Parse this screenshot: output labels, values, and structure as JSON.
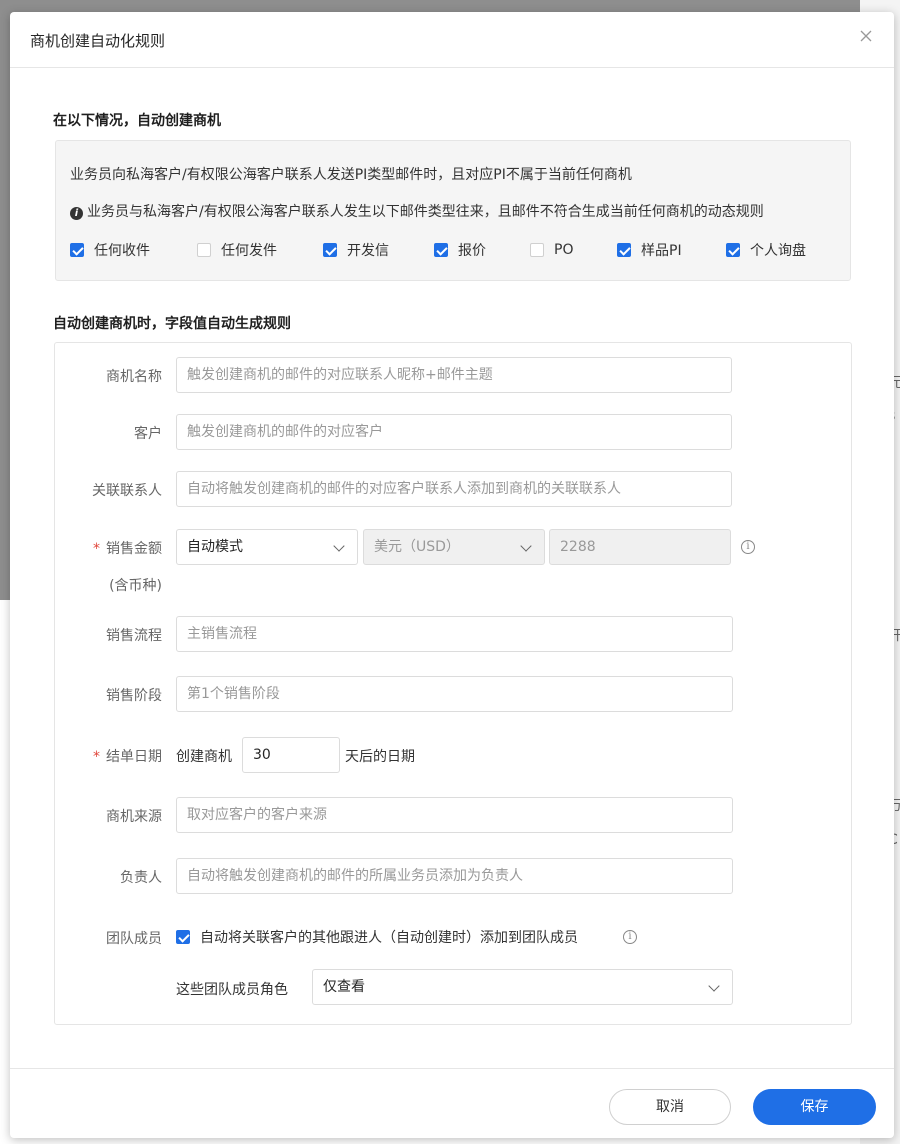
{
  "background": {
    "marks": [
      "I",
      "I",
      "元",
      "s",
      "开",
      "万",
      "C"
    ]
  },
  "dialog": {
    "title": "商机创建自动化规则"
  },
  "trigger_section": {
    "title": "在以下情况，自动创建商机",
    "line1": "业务员向私海客户/有权限公海客户联系人发送PI类型邮件时，且对应PI不属于当前任何商机",
    "line2": "业务员与私海客户/有权限公海客户联系人发生以下邮件类型往来，且邮件不符合生成当前任何商机的动态规则",
    "checkboxes": [
      {
        "label": "任何收件",
        "checked": true
      },
      {
        "label": "任何发件",
        "checked": false
      },
      {
        "label": "开发信",
        "checked": true
      },
      {
        "label": "报价",
        "checked": true
      },
      {
        "label": "PO",
        "checked": false
      },
      {
        "label": "样品PI",
        "checked": true
      },
      {
        "label": "个人询盘",
        "checked": true
      }
    ]
  },
  "rules_section": {
    "title": "自动创建商机时，字段值自动生成规则",
    "fields": {
      "name": {
        "label": "商机名称",
        "placeholder": "触发创建商机的邮件的对应联系人昵称+邮件主题"
      },
      "customer": {
        "label": "客户",
        "placeholder": "触发创建商机的邮件的对应客户"
      },
      "contacts": {
        "label": "关联联系人",
        "placeholder": "自动将触发创建商机的邮件的对应客户联系人添加到商机的关联联系人"
      },
      "amount": {
        "label": "销售金额",
        "sub_label": "(含币种)",
        "required_mark": "*",
        "mode_value": "自动模式",
        "currency_value": "美元（USD）",
        "amount_value": "2288"
      },
      "process": {
        "label": "销售流程",
        "placeholder": "主销售流程"
      },
      "stage": {
        "label": "销售阶段",
        "placeholder": "第1个销售阶段"
      },
      "close_date": {
        "label": "结单日期",
        "required_mark": "*",
        "prefix": "创建商机",
        "days_value": "30",
        "suffix": "天后的日期"
      },
      "source": {
        "label": "商机来源",
        "placeholder": "取对应客户的客户来源"
      },
      "owner": {
        "label": "负责人",
        "placeholder": "自动将触发创建商机的邮件的所属业务员添加为负责人"
      },
      "team": {
        "label": "团队成员",
        "checkbox_label": "自动将关联客户的其他跟进人（自动创建时）添加到团队成员",
        "checked": true,
        "role_label": "这些团队成员角色",
        "role_value": "仅查看"
      }
    }
  },
  "footer": {
    "cancel_label": "取消",
    "save_label": "保存"
  },
  "colors": {
    "primary": "#1f6fe6",
    "required": "#e0453a"
  }
}
